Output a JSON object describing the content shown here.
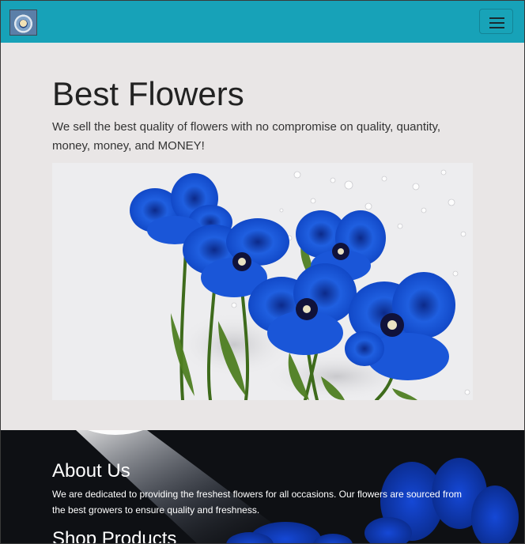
{
  "navbar": {
    "brand_logo_icon": "flower-logo-icon",
    "toggler_icon": "hamburger-menu-icon",
    "color": "#17a2b8"
  },
  "hero": {
    "title": "Best Flowers",
    "description": "We sell the best quality of flowers with no compromise on quality, quantity, money, money, and MONEY!",
    "image_icon": "blue-flowers-image"
  },
  "about": {
    "title": "About Us",
    "text": "We are dedicated to providing the freshest flowers for all occasions. Our flowers are sourced from the best growers to ensure quality and freshness.",
    "next_section_title": "Shop Products"
  }
}
